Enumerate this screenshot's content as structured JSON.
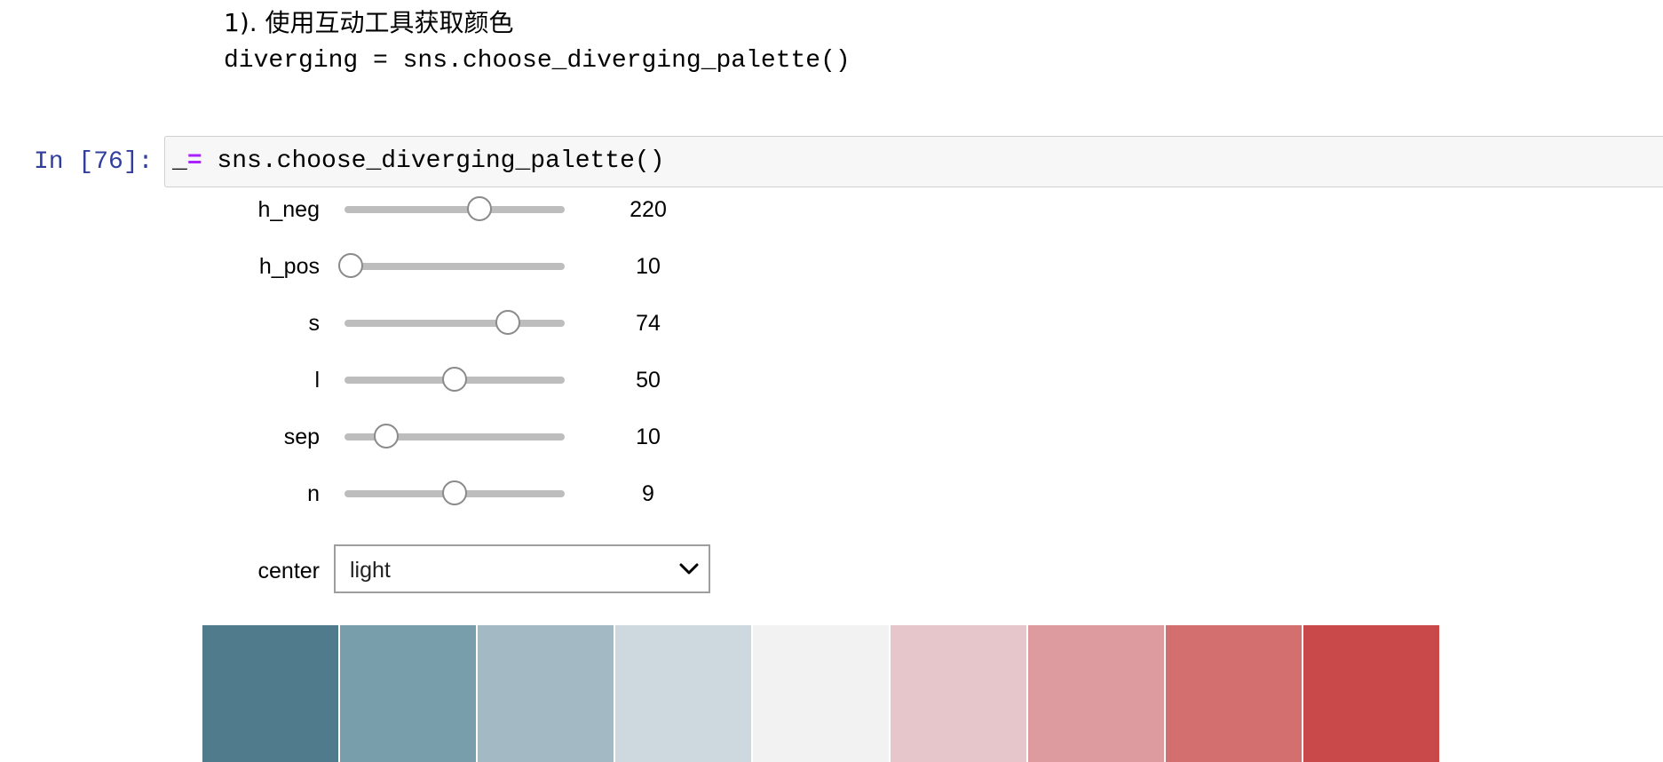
{
  "markdown": {
    "heading": "1). 使用互动工具获取颜色",
    "code_line": "diverging = sns.choose_diverging_palette()"
  },
  "cell": {
    "prompt": "In [76]:",
    "code_var": "_",
    "code_op": "=",
    "code_rest": " sns.choose_diverging_palette()"
  },
  "widgets": {
    "sliders": [
      {
        "label": "h_neg",
        "value": "220",
        "fraction": 0.611
      },
      {
        "label": "h_pos",
        "value": "10",
        "fraction": 0.028
      },
      {
        "label": "s",
        "value": "74",
        "fraction": 0.74
      },
      {
        "label": "l",
        "value": "50",
        "fraction": 0.5
      },
      {
        "label": "sep",
        "value": "10",
        "fraction": 0.19
      },
      {
        "label": "n",
        "value": "9",
        "fraction": 0.5
      }
    ],
    "center": {
      "label": "center",
      "selected": "light"
    }
  },
  "palette": {
    "colors": [
      "#4f7b8c",
      "#789eab",
      "#a3bac4",
      "#cdd9de",
      "#f2f2f2",
      "#e6c6ca",
      "#dd9b9f",
      "#d3706f",
      "#c9494b"
    ]
  },
  "icons": {
    "dropdown": "chevron-down-icon"
  }
}
